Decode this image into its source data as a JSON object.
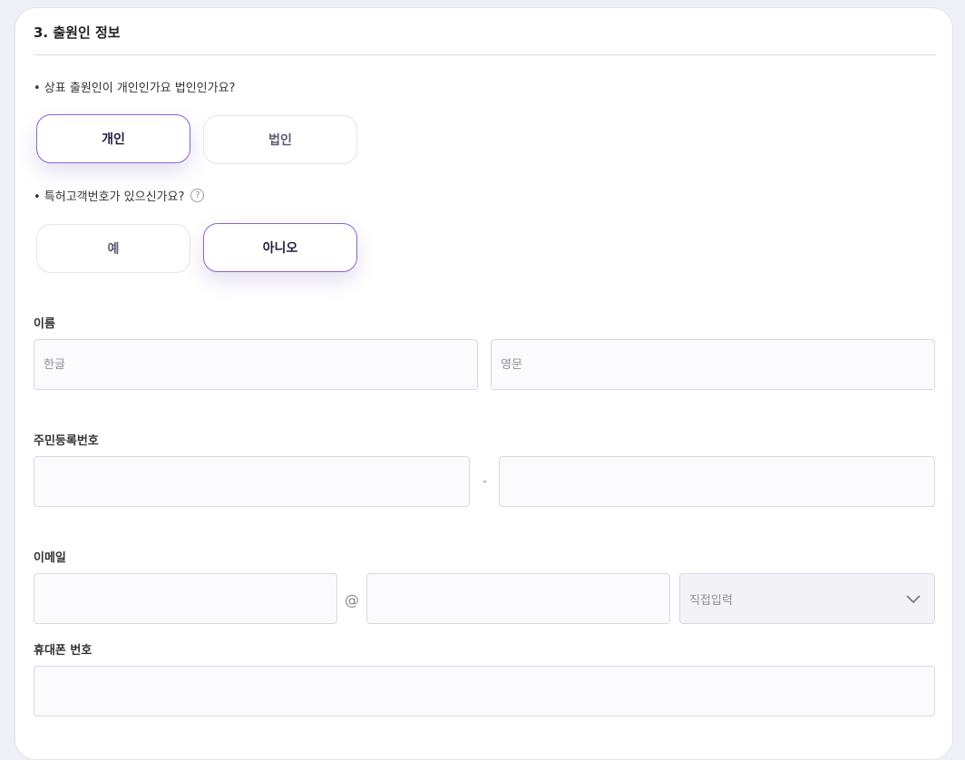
{
  "section": {
    "title": "3. 출원인 정보"
  },
  "applicant_type": {
    "question": "• 상표 출원인이 개인인가요 법인인가요?",
    "options": [
      "개인",
      "법인"
    ],
    "selected": "개인"
  },
  "customer_number": {
    "question": "• 특허고객번호가 있으신가요?",
    "help_icon": "?",
    "options": [
      "예",
      "아니오"
    ],
    "selected": "아니오"
  },
  "name": {
    "label": "이름",
    "korean_placeholder": "한글",
    "english_placeholder": "영문"
  },
  "rrn": {
    "label": "주민등록번호",
    "separator": "-"
  },
  "email": {
    "label": "이메일",
    "at_sign": "@",
    "domain_select": "직접입력"
  },
  "phone": {
    "label": "휴대폰 번호"
  },
  "colors": {
    "accent": "#8a63d2",
    "background": "#eeeff7"
  }
}
